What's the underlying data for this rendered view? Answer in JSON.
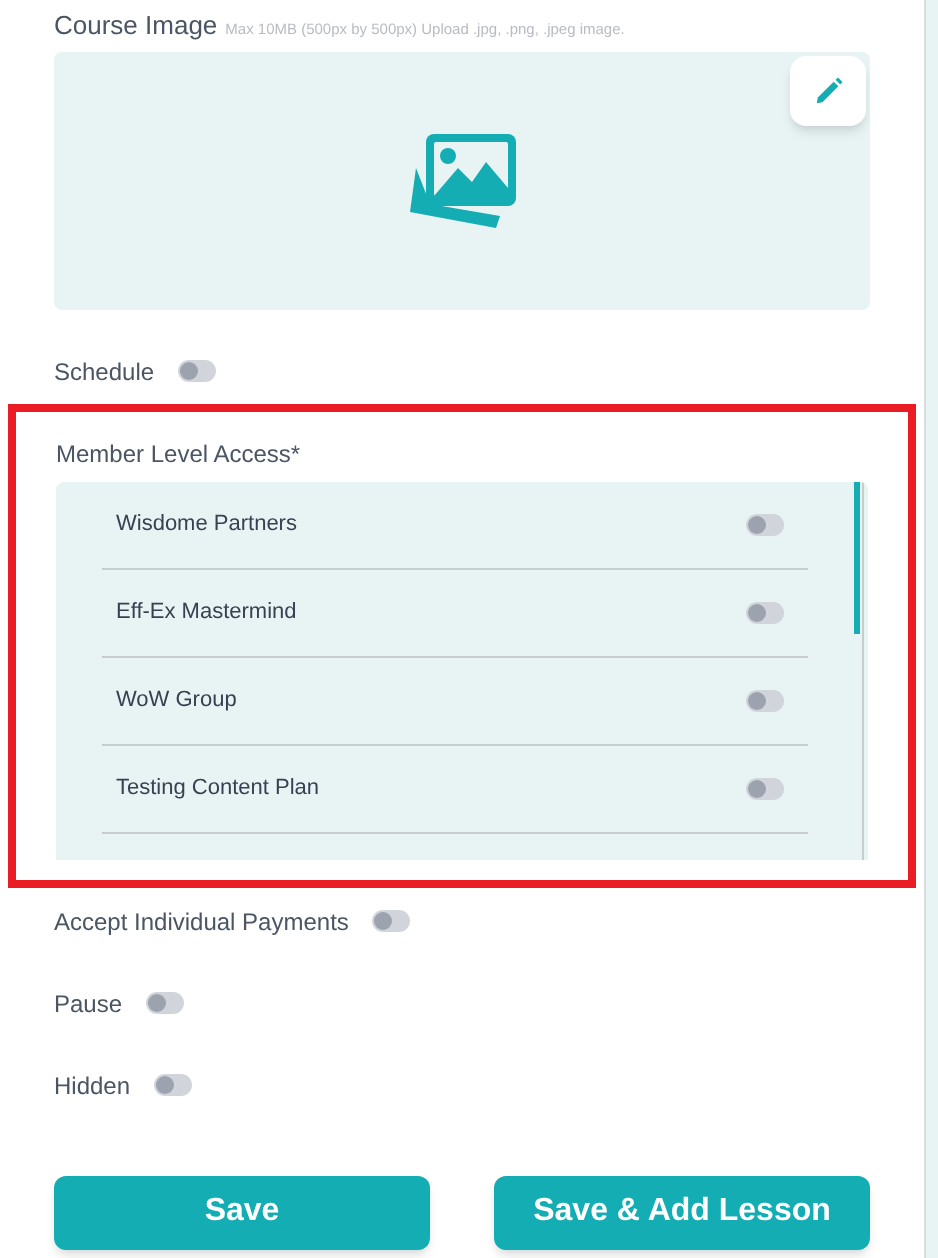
{
  "course_image": {
    "label": "Course Image",
    "hint": "Max 10MB (500px by 500px) Upload .jpg, .png, .jpeg image."
  },
  "schedule": {
    "label": "Schedule",
    "on": false
  },
  "member_level_access": {
    "label": "Member Level Access*",
    "items": [
      {
        "label": "Wisdome Partners",
        "on": false
      },
      {
        "label": "Eff-Ex Mastermind",
        "on": false
      },
      {
        "label": "WoW Group",
        "on": false
      },
      {
        "label": "Testing Content Plan",
        "on": false
      }
    ]
  },
  "toggles": [
    {
      "label": "Accept Individual Payments",
      "on": false
    },
    {
      "label": "Pause",
      "on": false
    },
    {
      "label": "Hidden",
      "on": false
    }
  ],
  "buttons": [
    "Save",
    "Save & Add Lesson"
  ]
}
